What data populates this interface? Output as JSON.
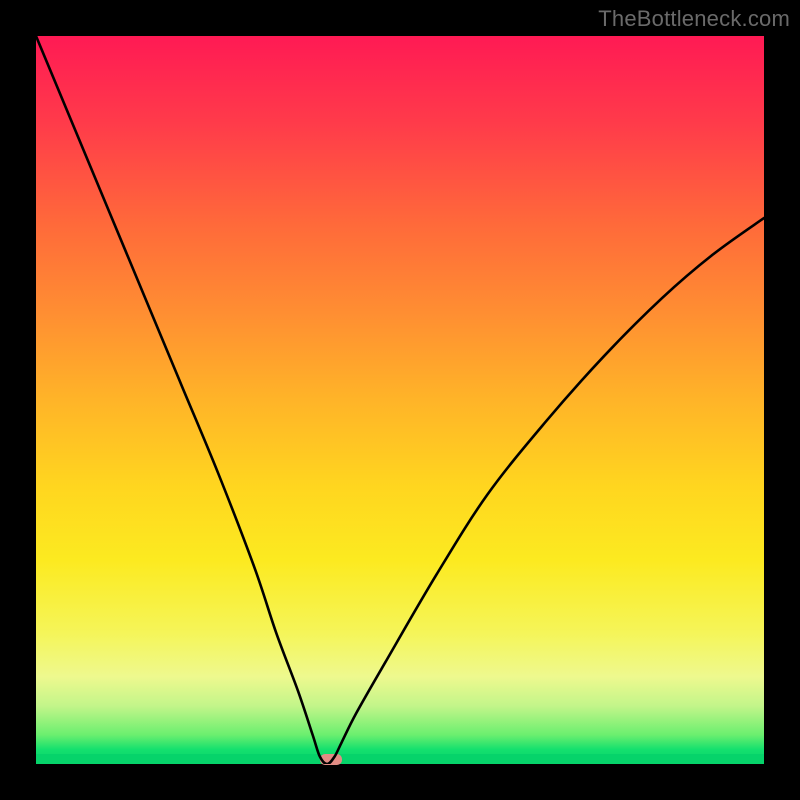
{
  "attribution": "TheBottleneck.com",
  "chart_data": {
    "type": "line",
    "title": "",
    "xlabel": "",
    "ylabel": "",
    "xlim": [
      0,
      100
    ],
    "ylim": [
      0,
      100
    ],
    "grid": false,
    "legend": false,
    "notes": "Gradient background red (top) through yellow to green (bottom). Single black curve with a deep narrow minimum near x≈40 reaching y≈0.",
    "series": [
      {
        "name": "curve",
        "x": [
          0,
          5,
          10,
          15,
          20,
          25,
          30,
          33,
          36,
          38,
          39,
          40,
          41,
          42,
          44,
          48,
          55,
          62,
          70,
          78,
          86,
          93,
          100
        ],
        "y": [
          100,
          88,
          76,
          64,
          52,
          40,
          27,
          18,
          10,
          4,
          1,
          0,
          1,
          3,
          7,
          14,
          26,
          37,
          47,
          56,
          64,
          70,
          75
        ]
      }
    ],
    "marker": {
      "x": 40.5,
      "y": 0.6,
      "color": "#e28c84"
    }
  },
  "colors": {
    "top": "#ff1a54",
    "mid": "#ffd61f",
    "bottom": "#06d36a",
    "curve": "#000000",
    "marker": "#e28c84",
    "frame": "#000000",
    "attribution_text": "#6a6a6a"
  }
}
